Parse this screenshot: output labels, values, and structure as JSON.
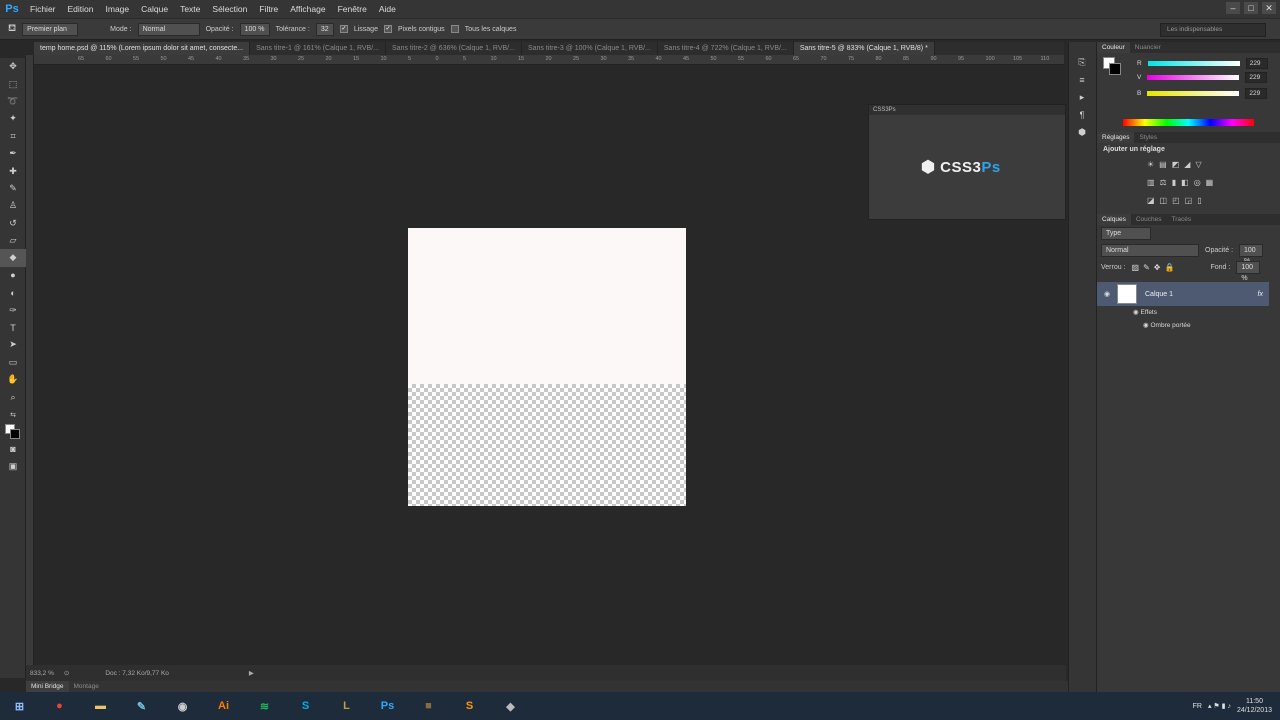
{
  "app": {
    "logo": "Ps"
  },
  "menu": [
    "Fichier",
    "Edition",
    "Image",
    "Calque",
    "Texte",
    "Sélection",
    "Filtre",
    "Affichage",
    "Fenêtre",
    "Aide"
  ],
  "window_controls": [
    "–",
    "□",
    "✕"
  ],
  "options": {
    "preset": "Premier plan",
    "mode_label": "Mode :",
    "mode_value": "Normal",
    "opacity_label": "Opacité :",
    "opacity_value": "100 %",
    "tolerance_label": "Tolérance :",
    "tolerance_value": "32",
    "lissage": "Lissage",
    "pixels_contigus": "Pixels contigus",
    "tous_calques": "Tous les calques",
    "workspace": "Les indispensables"
  },
  "tabs": [
    "temp home.psd @ 115% (Lorem ipsum dolor sit amet, consecte...",
    "Sans titre-1 @ 161% (Calque 1, RVB/...",
    "Sans titre-2 @ 636% (Calque 1, RVB/...",
    "Sans titre-3 @ 100% (Calque 1, RVB/...",
    "Sans titre-4 @ 722% (Calque 1, RVB/...",
    "Sans titre-5 @ 833% (Calque 1, RVB/8) *"
  ],
  "ruler_ticks": [
    "65",
    "60",
    "55",
    "50",
    "45",
    "40",
    "35",
    "30",
    "25",
    "20",
    "15",
    "10",
    "5",
    "0",
    "5",
    "10",
    "15",
    "20",
    "25",
    "30",
    "35",
    "40",
    "45",
    "50",
    "55",
    "60",
    "65",
    "70",
    "75",
    "80",
    "85",
    "90",
    "95",
    "100",
    "105",
    "110"
  ],
  "status": {
    "zoom": "833,2 %",
    "doc": "Doc : 7,32 Ko/9,77 Ko"
  },
  "bottom_tabs": [
    "Mini Bridge",
    "Montage"
  ],
  "css3ps": {
    "header": "CSS3Ps",
    "logo_main": "CSS3",
    "logo_accent": "Ps"
  },
  "color_panel": {
    "tabs": [
      "Couleur",
      "Nuancier"
    ],
    "channels": [
      {
        "label": "R",
        "value": "229"
      },
      {
        "label": "V",
        "value": "229"
      },
      {
        "label": "B",
        "value": "229"
      }
    ]
  },
  "adjust_panel": {
    "tabs": [
      "Réglages",
      "Styles"
    ],
    "title": "Ajouter un réglage"
  },
  "layers_panel": {
    "tabs": [
      "Calques",
      "Couches",
      "Tracés"
    ],
    "filter": "Type",
    "blend": "Normal",
    "opacity_label": "Opacité :",
    "opacity_value": "100 %",
    "lock_label": "Verrou :",
    "fill_label": "Fond :",
    "fill_value": "100 %",
    "layer_name": "Calque 1",
    "fx": "fx",
    "effects": "Effets",
    "effect_item": "Ombre portée"
  },
  "taskbar": {
    "apps": [
      {
        "name": "chrome",
        "glyph": "●",
        "color": "#e8453c"
      },
      {
        "name": "explorer",
        "glyph": "▬",
        "color": "#e9c46a"
      },
      {
        "name": "app3",
        "glyph": "✎",
        "color": "#6ec1e4"
      },
      {
        "name": "app4",
        "glyph": "◉",
        "color": "#cccccc"
      },
      {
        "name": "illustrator",
        "glyph": "Ai",
        "color": "#ff7c00"
      },
      {
        "name": "spotify",
        "glyph": "≋",
        "color": "#1db954"
      },
      {
        "name": "skype",
        "glyph": "S",
        "color": "#00aff0"
      },
      {
        "name": "league",
        "glyph": "L",
        "color": "#c89b3c"
      },
      {
        "name": "photoshop",
        "glyph": "Ps",
        "color": "#31a8ff"
      },
      {
        "name": "minecraft",
        "glyph": "■",
        "color": "#8b6b3d"
      },
      {
        "name": "sublime",
        "glyph": "S",
        "color": "#ff9800"
      },
      {
        "name": "app12",
        "glyph": "◆",
        "color": "#bbbbbb"
      }
    ],
    "lang": "FR",
    "time": "11:50",
    "date": "24/12/2013"
  }
}
